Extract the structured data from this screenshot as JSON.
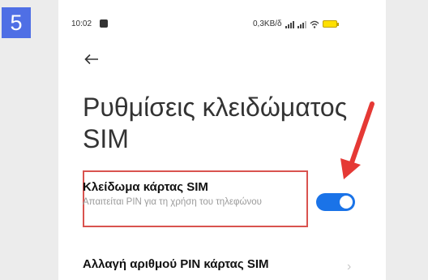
{
  "step_number": "5",
  "status_bar": {
    "time": "10:02",
    "network_speed": "0,3KB/δ"
  },
  "header": {
    "title": "Ρυθμίσεις κλειδώματος SIM"
  },
  "settings": {
    "sim_lock": {
      "title": "Κλείδωμα κάρτας SIM",
      "subtitle": "Απαιτείται PIN για τη χρήση του τηλεφώνου",
      "enabled": true
    },
    "change_pin": {
      "title": "Αλλαγή αριθμού PIN κάρτας SIM"
    }
  },
  "colors": {
    "badge": "#4f6fe5",
    "toggle_on": "#1a73e8",
    "annotation": "#e53935"
  },
  "icons": {
    "back": "back-arrow-icon",
    "chevron": "chevron-right-icon",
    "wifi": "wifi-icon",
    "battery": "battery-icon"
  }
}
